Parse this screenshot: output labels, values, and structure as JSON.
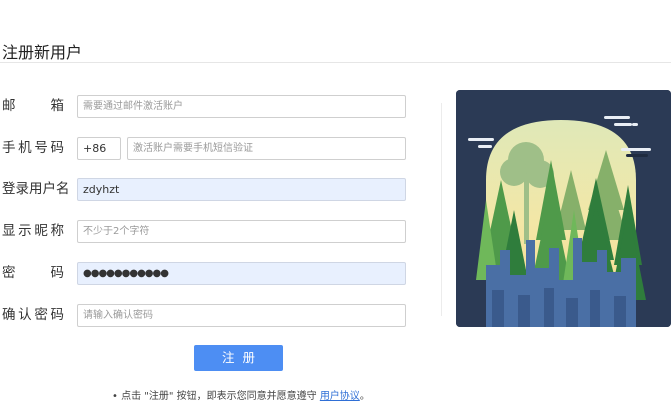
{
  "page": {
    "title": "注册新用户"
  },
  "form": {
    "email": {
      "label": "邮 箱",
      "label_chars": [
        "邮",
        "箱"
      ],
      "placeholder": "需要通过邮件激活账户",
      "value": ""
    },
    "phone": {
      "label": "手机号码",
      "label_chars": [
        "手",
        "机",
        "号",
        "码"
      ],
      "prefix": "+86",
      "placeholder": "激活账户需要手机短信验证",
      "value": ""
    },
    "username": {
      "label": "登录用户名",
      "label_chars": [
        "登录用户名"
      ],
      "value": "zdyhzt"
    },
    "nickname": {
      "label": "显示昵称",
      "label_chars": [
        "显",
        "示",
        "昵",
        "称"
      ],
      "placeholder": "不少于2个字符",
      "value": ""
    },
    "password": {
      "label": "密 码",
      "label_chars": [
        "密",
        "码"
      ],
      "value": "●●●●●●●●●●●"
    },
    "confirm": {
      "label": "确认密码",
      "label_chars": [
        "确",
        "认",
        "密",
        "码"
      ],
      "placeholder": "请输入确认密码",
      "value": ""
    }
  },
  "submit": {
    "label": "注册"
  },
  "agreement": {
    "text": "• 点击 \"注册\" 按钮，即表示您同意并愿意遵守 ",
    "link": "用户协议",
    "suffix": "。"
  },
  "colors": {
    "accent": "#4d8ef3",
    "illustration_bg": "#2b3a55",
    "autofill": "#e8f0fe"
  }
}
